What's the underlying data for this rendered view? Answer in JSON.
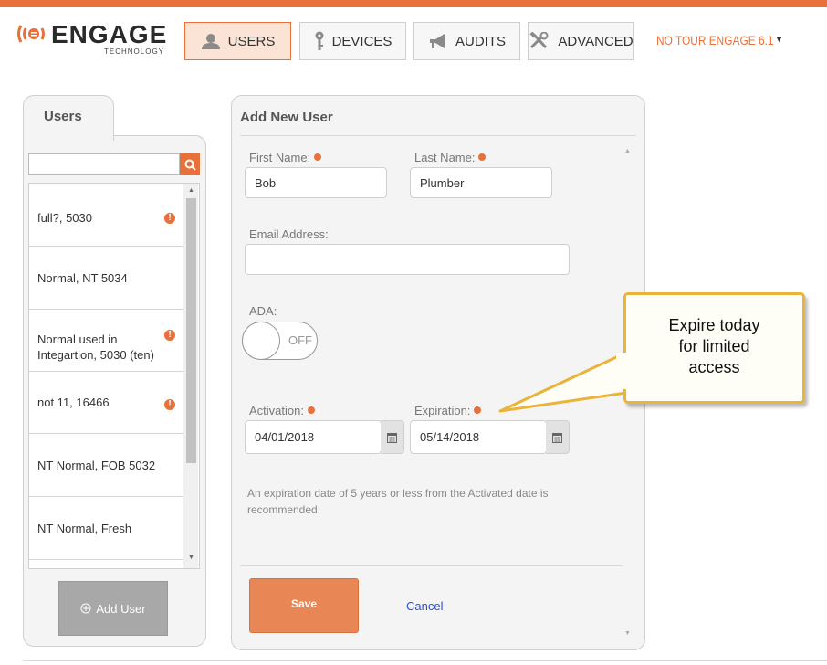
{
  "header": {
    "logo_text": "ENGAGE",
    "logo_subtext": "TECHNOLOGY",
    "nav": [
      {
        "label": "USERS",
        "icon": "person-icon",
        "active": true
      },
      {
        "label": "DEVICES",
        "icon": "key-icon",
        "active": false
      },
      {
        "label": "AUDITS",
        "icon": "megaphone-icon",
        "active": false
      },
      {
        "label": "ADVANCED",
        "icon": "tools-icon",
        "active": false
      }
    ],
    "site_selector": "NO TOUR ENGAGE 6.1",
    "site_selector_arrow": "▼"
  },
  "users_panel": {
    "tab_label": "Users",
    "search_value": "",
    "items": [
      {
        "name": "full?, 5030",
        "warning": true
      },
      {
        "name": "Normal, NT 5034",
        "warning": false
      },
      {
        "name": "Normal used in",
        "name_cont": "Integartion, 5030 (ten)",
        "warning": true
      },
      {
        "name": "not 11, 16466",
        "warning": true
      },
      {
        "name": "NT Normal, FOB 5032",
        "warning": false
      },
      {
        "name": "NT Normal, Fresh",
        "warning": false
      }
    ],
    "add_user_label": "Add User"
  },
  "form": {
    "title": "Add New User",
    "first_name_label": "First Name:",
    "first_name_value": "Bob",
    "last_name_label": "Last Name:",
    "last_name_value": "Plumber",
    "email_label": "Email Address:",
    "email_value": "",
    "ada_label": "ADA:",
    "ada_toggle_text": "OFF",
    "activation_label": "Activation:",
    "activation_value": "04/01/2018",
    "expiration_label": "Expiration:",
    "expiration_value": "05/14/2018",
    "hint": "An expiration date of 5 years or less from the Activated date is recommended.",
    "save_label": "Save",
    "cancel_label": "Cancel"
  },
  "callout": {
    "line1": "Expire today",
    "line2": "for limited",
    "line3": "access"
  },
  "colors": {
    "brand_orange": "#e8703a",
    "callout_border": "#eab33a",
    "link_blue": "#2d4fcf"
  }
}
